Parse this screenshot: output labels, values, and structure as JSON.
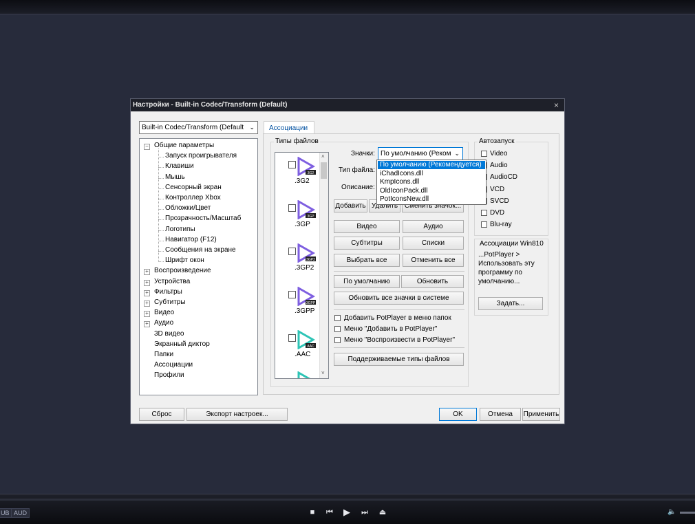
{
  "player": {
    "tags": [
      "UB",
      "AUD"
    ],
    "controls": [
      "■",
      "⏮",
      "▶",
      "⏭",
      "⏏"
    ],
    "volume_icon": "speaker-icon"
  },
  "dialog": {
    "title": "Настройки - Built-in Codec/Transform (Default)",
    "close": "×",
    "profile_select": "Built-in Codec/Transform (Default",
    "tab": "Ассоциации",
    "tree": [
      {
        "label": "Общие параметры",
        "level": 0,
        "exp": "−"
      },
      {
        "label": "Запуск проигрывателя",
        "level": 1
      },
      {
        "label": "Клавиши",
        "level": 1
      },
      {
        "label": "Мышь",
        "level": 1
      },
      {
        "label": "Сенсорный экран",
        "level": 1
      },
      {
        "label": "Контроллер Xbox",
        "level": 1
      },
      {
        "label": "Обложки/Цвет",
        "level": 1
      },
      {
        "label": "Прозрачность/Масштаб",
        "level": 1
      },
      {
        "label": "Логотипы",
        "level": 1
      },
      {
        "label": "Навигатор (F12)",
        "level": 1
      },
      {
        "label": "Сообщения на экране",
        "level": 1
      },
      {
        "label": "Шрифт окон",
        "level": 1
      },
      {
        "label": "Воспроизведение",
        "level": 0,
        "exp": "+"
      },
      {
        "label": "Устройства",
        "level": 0,
        "exp": "+"
      },
      {
        "label": "Фильтры",
        "level": 0,
        "exp": "+"
      },
      {
        "label": "Субтитры",
        "level": 0,
        "exp": "+"
      },
      {
        "label": "Видео",
        "level": 0,
        "exp": "+"
      },
      {
        "label": "Аудио",
        "level": 0,
        "exp": "+"
      },
      {
        "label": "3D видео",
        "level": 0
      },
      {
        "label": "Экранный диктор",
        "level": 0
      },
      {
        "label": "Папки",
        "level": 0
      },
      {
        "label": "Ассоциации",
        "level": 0
      },
      {
        "label": "Профили",
        "level": 0
      }
    ],
    "file_types_group": "Типы файлов",
    "files": [
      {
        "ext": ".3G2",
        "badge": "3G2",
        "color": "#7e5fe0"
      },
      {
        "ext": ".3GP",
        "badge": "3GP",
        "color": "#7e5fe0"
      },
      {
        "ext": ".3GP2",
        "badge": "3GP2",
        "color": "#7e5fe0"
      },
      {
        "ext": ".3GPP",
        "badge": "3GPP",
        "color": "#7e5fe0"
      },
      {
        "ext": ".AAC",
        "badge": "AAC",
        "color": "#2ec4b6"
      }
    ],
    "icons_label": "Значки:",
    "icons_value": "По умолчанию (Реком",
    "file_type_label": "Тип файла:",
    "description_label": "Описание:",
    "dropdown_options": [
      "По умолчанию (Рекомендуется)",
      "iChadIcons.dll",
      "KmpIcons.dll",
      "OldIconPack.dll",
      "PotIconsNew.dll"
    ],
    "btn_add": "Добавить",
    "btn_remove": "Удалить",
    "btn_change_icon": "Сменить значок...",
    "btn_video": "Видео",
    "btn_audio": "Аудио",
    "btn_subtitles": "Субтитры",
    "btn_lists": "Списки",
    "btn_select_all": "Выбрать все",
    "btn_deselect_all": "Отменить все",
    "btn_default": "По умолчанию",
    "btn_update": "Обновить",
    "btn_update_icons": "Обновить все значки в системе",
    "chk_add_folder_menu": "Добавить PotPlayer в меню папок",
    "chk_menu_add": "Меню \"Добавить в PotPlayer\"",
    "chk_menu_play": "Меню \"Воспроизвести в PotPlayer\"",
    "btn_supported_types": "Поддерживаемые типы файлов",
    "autorun_group": "Автозапуск",
    "autorun_items": [
      "Video",
      "Audio",
      "AudioCD",
      "VCD",
      "SVCD",
      "DVD",
      "Blu-ray"
    ],
    "win810_group": "Ассоциации Win810",
    "win810_text": [
      "...PotPlayer >",
      "Использовать эту",
      "программу по",
      "умолчанию..."
    ],
    "btn_set": "Задать...",
    "btn_reset": "Сброс",
    "btn_export": "Экспорт настроек...",
    "btn_ok": "OK",
    "btn_cancel": "Отмена",
    "btn_apply": "Применить"
  }
}
